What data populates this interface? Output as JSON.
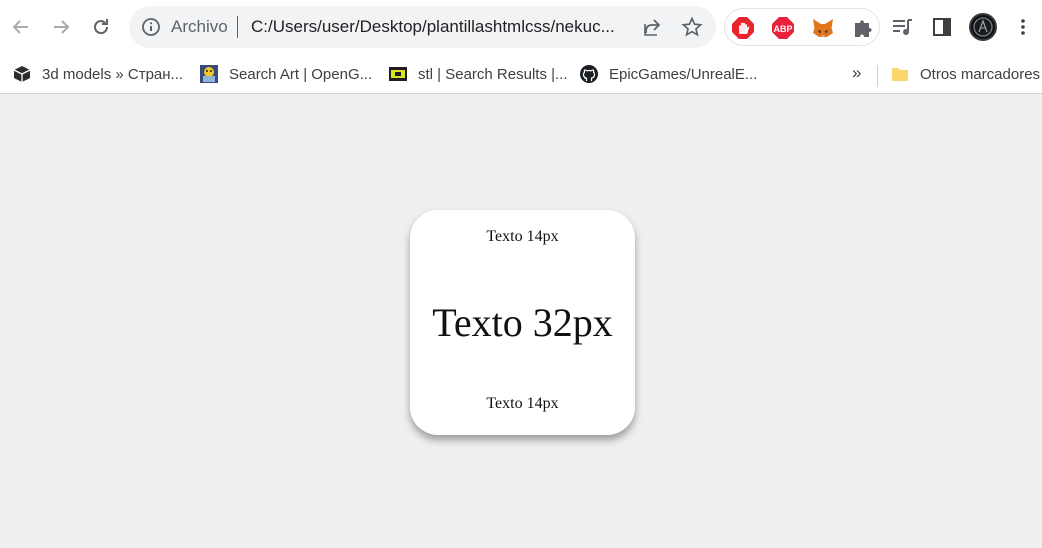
{
  "browser": {
    "omnibox": {
      "site_chip": "Archivo",
      "url": "C:/Users/user/Desktop/plantillashtmlcss/nekuc..."
    },
    "bookmarks": [
      {
        "label": "3d models » Стран...",
        "icon": "cube-icon"
      },
      {
        "label": "Search Art | OpenG...",
        "icon": "opengameart-icon"
      },
      {
        "label": "stl | Search Results |...",
        "icon": "stl-site-icon"
      },
      {
        "label": "EpicGames/UnrealE...",
        "icon": "github-icon"
      }
    ],
    "more_bookmarks": "»",
    "other_bookmarks": "Otros marcadores",
    "extensions": [
      "adblock-icon",
      "abp-icon",
      "metamask-fox-icon",
      "puzzle-extensions-icon"
    ],
    "extension_labels": {
      "abp": "ABP"
    }
  },
  "page": {
    "background": "#efefef",
    "card": {
      "top_text": "Texto 14px",
      "middle_text": "Texto 32px",
      "bottom_text": "Texto 14px"
    }
  },
  "colors": {
    "adblock": "#e8232c",
    "abp": "#e9213a",
    "metamask": "#e2761b",
    "folder": "#f8d66b"
  }
}
